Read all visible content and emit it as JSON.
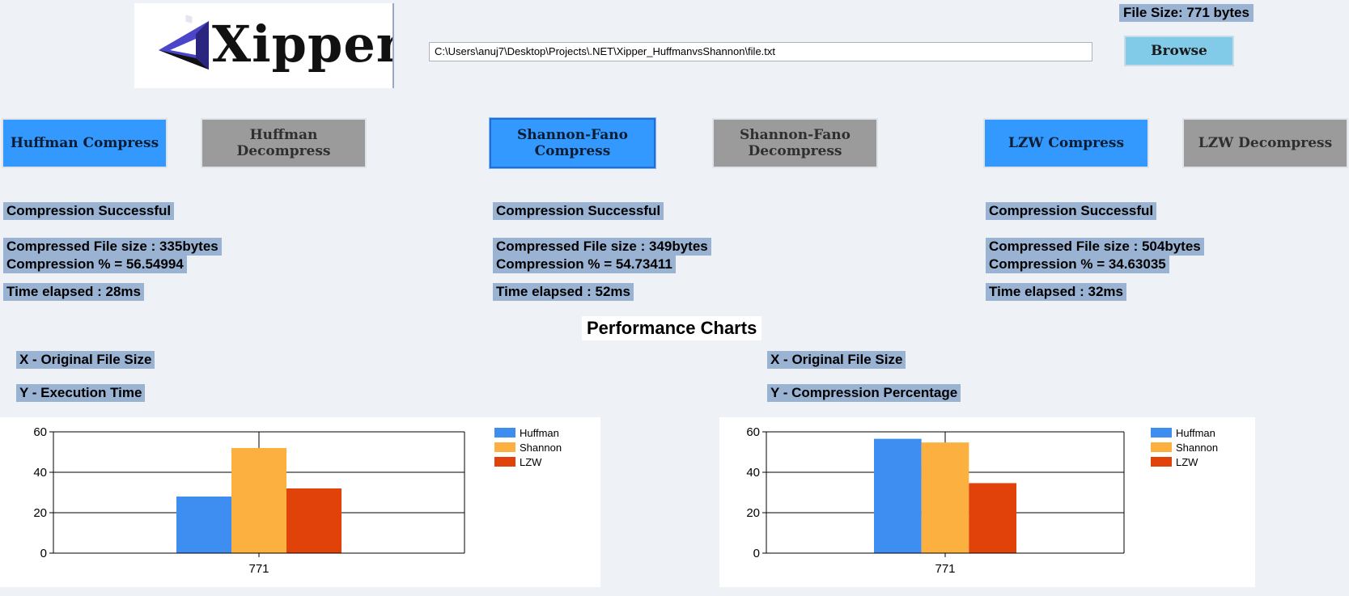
{
  "header": {
    "logo_text": "Xipper",
    "path_value": "C:\\Users\\anuj7\\Desktop\\Projects\\.NET\\Xipper_HuffmanvsShannon\\file.txt",
    "file_size": "File Size: 771 bytes",
    "browse_label": "Browse"
  },
  "buttons": {
    "huffman_compress": "Huffman Compress",
    "huffman_decompress_1": "Huffman",
    "huffman_decompress_2": "Decompress",
    "shannon_compress_1": "Shannon-Fano",
    "shannon_compress_2": "Compress",
    "shannon_decompress_1": "Shannon-Fano",
    "shannon_decompress_2": "Decompress",
    "lzw_compress": "LZW Compress",
    "lzw_decompress": "LZW Decompress"
  },
  "results": {
    "huffman": {
      "status": "Compression Successful",
      "size": "Compressed File size : 335bytes",
      "percent": "Compression % = 56.54994",
      "time": "Time elapsed : 28ms"
    },
    "shannon": {
      "status": "Compression Successful",
      "size": "Compressed File size : 349bytes",
      "percent": "Compression % = 54.73411",
      "time": "Time elapsed : 52ms"
    },
    "lzw": {
      "status": "Compression Successful",
      "size": "Compressed File size : 504bytes",
      "percent": "Compression % = 34.63035",
      "time": "Time elapsed : 32ms"
    }
  },
  "performance": {
    "title": "Performance Charts",
    "left_x_label": "X - Original File Size",
    "left_y_label": "Y - Execution Time",
    "right_x_label": "X - Original File Size",
    "right_y_label": "Y - Compression Percentage"
  },
  "colors": {
    "huffman": "#3d8ef0",
    "shannon": "#fbb040",
    "lzw": "#e0420a"
  },
  "chart_data": [
    {
      "type": "bar",
      "title": "",
      "xlabel": "",
      "ylabel": "",
      "categories": [
        "771"
      ],
      "ylim": [
        0,
        60
      ],
      "yticks": [
        0,
        20,
        40,
        60
      ],
      "series": [
        {
          "name": "Huffman",
          "values": [
            28
          ]
        },
        {
          "name": "Shannon",
          "values": [
            52
          ]
        },
        {
          "name": "LZW",
          "values": [
            32
          ]
        }
      ],
      "legend": "top-right",
      "grid": true
    },
    {
      "type": "bar",
      "title": "",
      "xlabel": "",
      "ylabel": "",
      "categories": [
        "771"
      ],
      "ylim": [
        0,
        60
      ],
      "yticks": [
        0,
        20,
        40,
        60
      ],
      "series": [
        {
          "name": "Huffman",
          "values": [
            56.54994
          ]
        },
        {
          "name": "Shannon",
          "values": [
            54.73411
          ]
        },
        {
          "name": "LZW",
          "values": [
            34.63035
          ]
        }
      ],
      "legend": "top-right",
      "grid": true
    }
  ]
}
